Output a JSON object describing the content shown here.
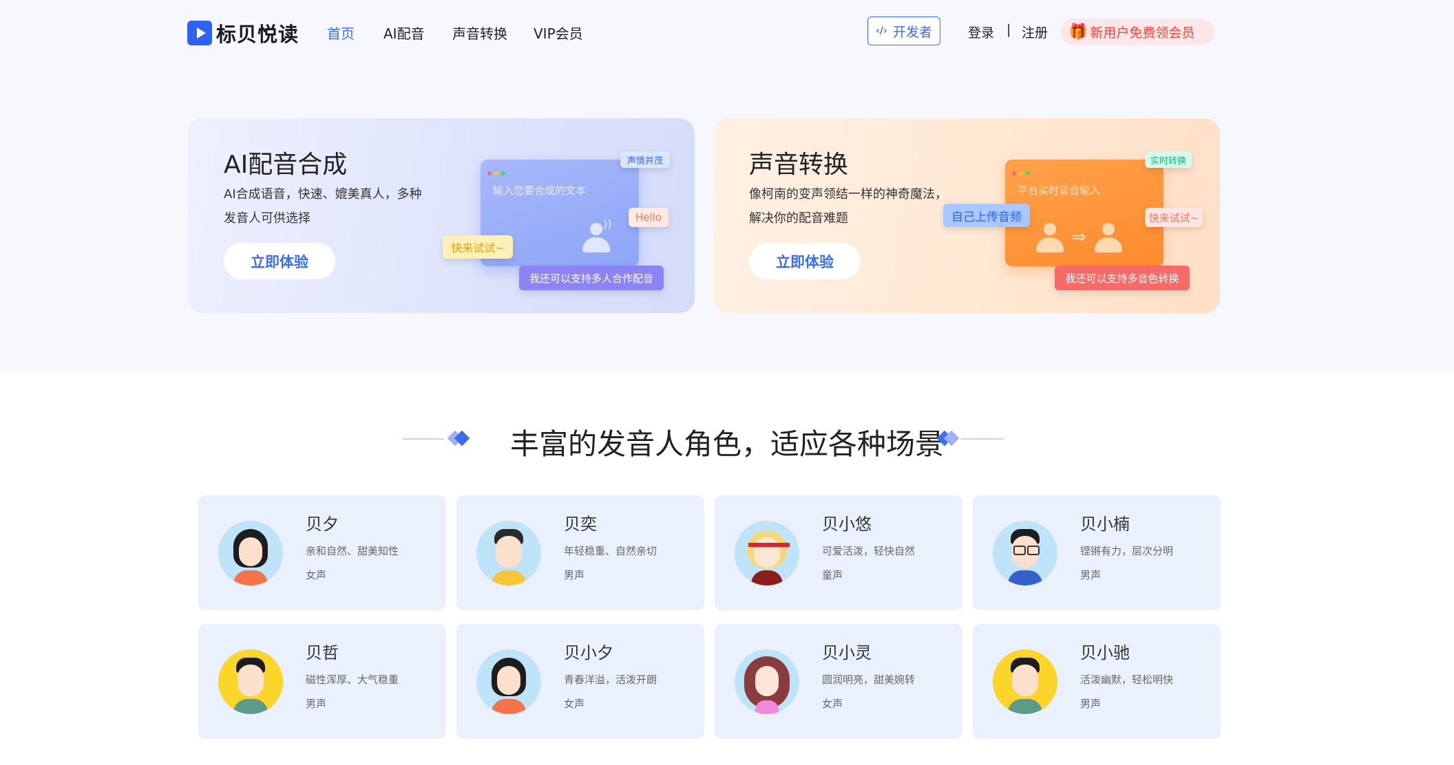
{
  "brand": {
    "name": "标贝悦读"
  },
  "nav": {
    "items": [
      "首页",
      "AI配音",
      "声音转换",
      "VIP会员"
    ],
    "developer": "开发者",
    "login": "登录",
    "separator": "|",
    "register": "注册",
    "promo": "新用户免费领会员"
  },
  "hero": {
    "ai": {
      "title": "AI配音合成",
      "desc": "AI合成语音，快速、媲美真人，多种发音人可供选择",
      "button": "立即体验",
      "placeholder": "输入您要合成的文本",
      "tag_emotion": "声情并茂",
      "tag_hello": "Hello",
      "tag_try": "快来试试~",
      "tag_multi": "我还可以支持多人合作配音"
    },
    "voice": {
      "title": "声音转换",
      "desc": "像柯南的变声领结一样的神奇魔法，解决你的配音难题",
      "button": "立即体验",
      "placeholder": "平台实时录音输入",
      "tag_realtime": "实时转换",
      "tag_upload": "自己上传音频",
      "tag_try": "快来试试~",
      "tag_multi": "我还可以支持多音色转换"
    }
  },
  "section": {
    "title": "丰富的发音人角色，适应各种场景"
  },
  "voices": [
    {
      "name": "贝夕",
      "desc": "亲和自然、甜美知性",
      "gender": "女声"
    },
    {
      "name": "贝奕",
      "desc": "年轻稳重、自然亲切",
      "gender": "男声"
    },
    {
      "name": "贝小悠",
      "desc": "可爱活泼，轻快自然",
      "gender": "童声"
    },
    {
      "name": "贝小楠",
      "desc": "铿锵有力，层次分明",
      "gender": "男声"
    },
    {
      "name": "贝哲",
      "desc": "磁性浑厚、大气稳重",
      "gender": "男声"
    },
    {
      "name": "贝小夕",
      "desc": "青春洋溢，活泼开朗",
      "gender": "女声"
    },
    {
      "name": "贝小灵",
      "desc": "圆润明亮，甜美婉转",
      "gender": "女声"
    },
    {
      "name": "贝小驰",
      "desc": "活泼幽默，轻松明快",
      "gender": "男声"
    }
  ],
  "colors": {
    "accent": "#3a6df0",
    "promo": "#f04a3a",
    "card_bg": "#ebf0fd"
  }
}
